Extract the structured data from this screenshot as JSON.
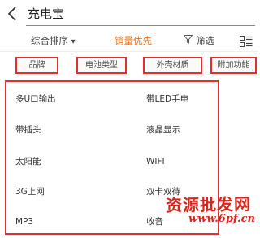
{
  "search": {
    "query": "充电宝"
  },
  "sort_bar": {
    "comprehensive": "综合排序",
    "comprehensive_arrow": "▾",
    "sales_first": "销量优先",
    "filter": "筛选"
  },
  "filter_tags": [
    {
      "label": "品牌"
    },
    {
      "label": "电池类型"
    },
    {
      "label": "外壳材质"
    },
    {
      "label": "附加功能"
    }
  ],
  "options": [
    {
      "label": "多U口输出"
    },
    {
      "label": "带LED手电"
    },
    {
      "label": "带插头"
    },
    {
      "label": "液晶显示"
    },
    {
      "label": "太阳能"
    },
    {
      "label": "WIFI"
    },
    {
      "label": "3G上网"
    },
    {
      "label": "双卡双待"
    },
    {
      "label": "MP3"
    },
    {
      "label": "收音"
    }
  ],
  "watermark": {
    "text": "资源批发网",
    "url": "www.6pf.cn"
  },
  "colors": {
    "accent": "#e2701f",
    "highlight_border": "#e23030",
    "watermark": "#d7261e"
  }
}
